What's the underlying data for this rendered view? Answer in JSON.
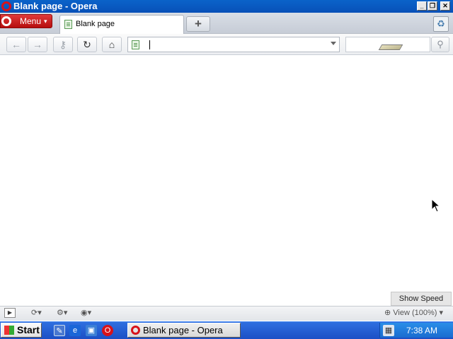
{
  "window": {
    "title": "Blank page - Opera"
  },
  "menu": {
    "label": "Menu"
  },
  "tabs": [
    {
      "label": "Blank page"
    }
  ],
  "address": {
    "value": ""
  },
  "content": {
    "speed_dial_button": "Show Speed Dial"
  },
  "statusbar": {
    "zoom": "View (100%)"
  },
  "taskbar": {
    "start_label": "Start",
    "task_button": "Blank page - Opera",
    "clock": "7:38 AM"
  },
  "icons": {
    "back": "back-arrow-icon",
    "forward": "forward-arrow-icon",
    "key": "key-icon",
    "reload": "reload-icon",
    "home": "home-icon",
    "search": "search-icon",
    "trash": "trash-icon"
  },
  "colors": {
    "title_bar": "#0a5bc4",
    "menu_button": "#c81818",
    "taskbar": "#245edb"
  }
}
